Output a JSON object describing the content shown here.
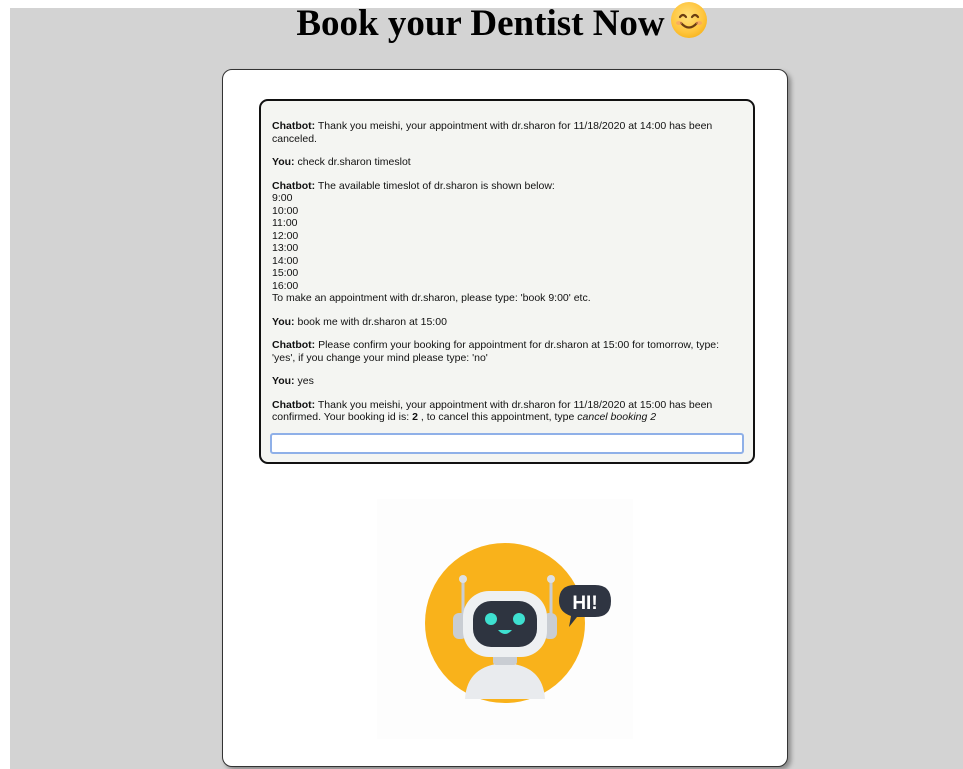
{
  "page": {
    "title": "Book your Dentist Now",
    "title_emoji": "smiling-face-emoji"
  },
  "chat": {
    "messages": [
      {
        "sender": "Chatbot:",
        "text": " Thank you meishi, your appointment with dr.sharon for 11/18/2020 at 14:00 has been canceled."
      },
      {
        "sender": "You:",
        "text": " check dr.sharon timeslot"
      },
      {
        "sender": "Chatbot:",
        "text": " The available timeslot of dr.sharon is shown below:",
        "slots": [
          "9:00",
          "10:00",
          "11:00",
          "12:00",
          "13:00",
          "14:00",
          "15:00",
          "16:00"
        ],
        "after": "To make an appointment with dr.sharon, please type: 'book 9:00' etc."
      },
      {
        "sender": "You:",
        "text": " book me with dr.sharon at 15:00"
      },
      {
        "sender": "Chatbot:",
        "text": " Please confirm your booking for appointment for dr.sharon at 15:00 for tomorrow, type: 'yes', if you change your mind please type: 'no'"
      },
      {
        "sender": "You:",
        "text": " yes"
      },
      {
        "sender": "Chatbot:",
        "text": " Thank you meishi, your appointment with dr.sharon for 11/18/2020 at 15:00 has been confirmed. Your booking id is: ",
        "booking_id": "2",
        "text2": " , to cancel this appointment, type ",
        "cancel_cmd": "cancel booking 2"
      }
    ],
    "input_value": ""
  },
  "illustration": {
    "bubble_text": "HI!",
    "colors": {
      "circle": "#f9b21b",
      "robot_face": "#2e3440",
      "eyes": "#3ee0d0",
      "bubble": "#2f3542"
    }
  },
  "colors": {
    "page_bg": "#d3d3d3",
    "card_bg": "#ffffff",
    "chat_bg": "#f4f5f2",
    "input_border": "#8fb0e8"
  }
}
